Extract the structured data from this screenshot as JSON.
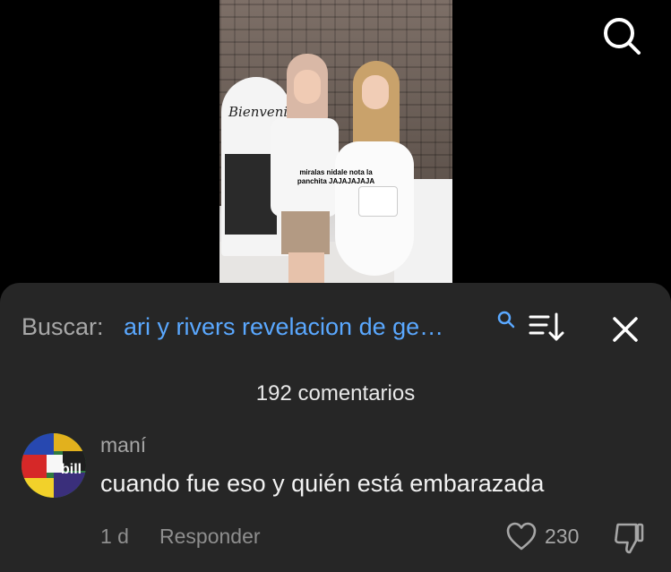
{
  "video": {
    "banner_text": "Bienveni",
    "caption": "miralas nidale nota la panchita JAJAJAJAJA"
  },
  "top": {
    "search_icon": "search-icon"
  },
  "comments_panel": {
    "search_label": "Buscar:",
    "search_query": "ari y rivers revelacion de ge…",
    "query_icon": "search-icon",
    "sort_icon": "sort-icon",
    "close_icon": "close-icon",
    "count_label": "192 comentarios",
    "comments": [
      {
        "author": "maní",
        "text": "cuando fue eso y quién está embarazada",
        "time": "1 d",
        "reply_label": "Responder",
        "likes": "230",
        "avatar_text": "bill"
      }
    ],
    "colors": {
      "panel_bg": "#262626",
      "query_link": "#5aa8ff",
      "muted_text": "#8e8e8e"
    }
  }
}
